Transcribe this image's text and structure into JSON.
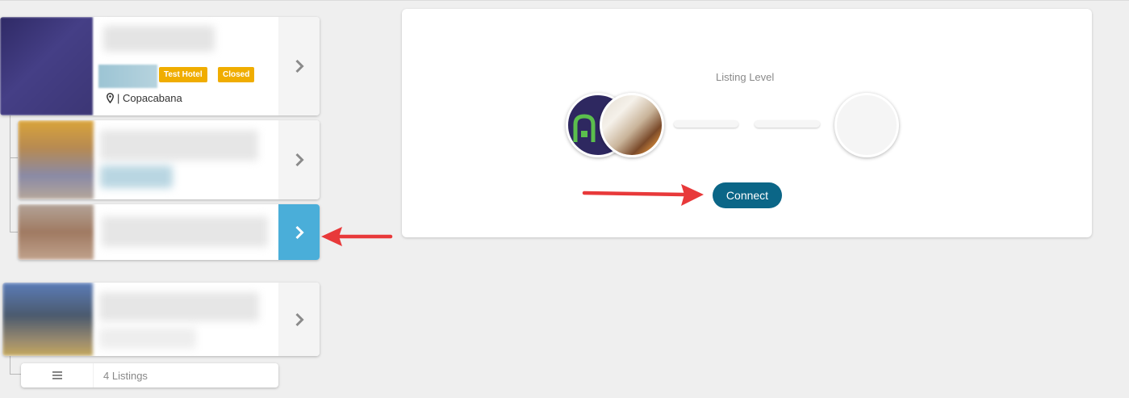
{
  "listings": [
    {
      "badges": [
        "Test Hotel",
        "Closed"
      ],
      "location": "| Copacabana"
    }
  ],
  "footer": {
    "count_label": "4 Listings"
  },
  "panel": {
    "title": "Listing Level",
    "connect_label": "Connect"
  },
  "colors": {
    "badge": "#f0ad00",
    "active_chevron": "#4aaed9",
    "connect": "#0b6687",
    "annotation_arrow": "#e8393a"
  },
  "icons": [
    "chevron-right-icon",
    "map-marker-icon",
    "menu-icon",
    "arrow-annotation-icon"
  ]
}
